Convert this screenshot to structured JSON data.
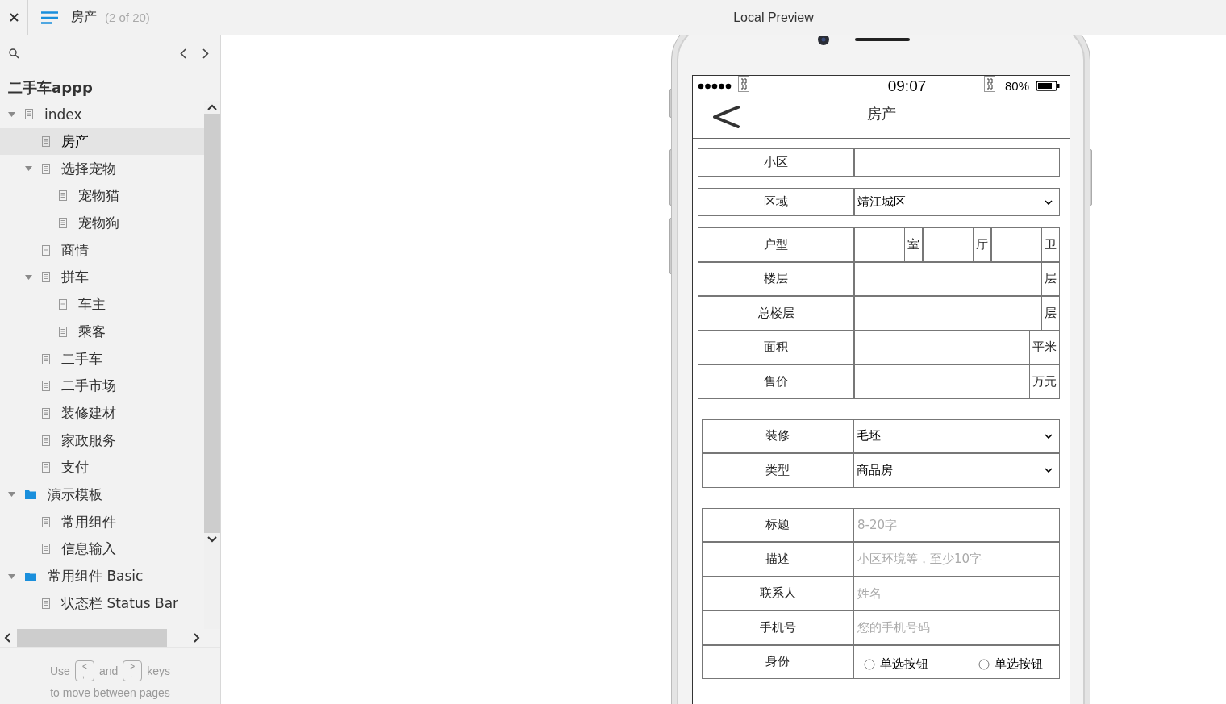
{
  "toolbar": {
    "page_title": "房产",
    "page_count": "(2 of 20)",
    "preview_title": "Local Preview"
  },
  "sidebar": {
    "project": "二手车appp",
    "tree": [
      {
        "label": "index",
        "kind": "page",
        "selected": false,
        "expanded": true,
        "children": [
          {
            "label": "房产",
            "kind": "page",
            "selected": true
          },
          {
            "label": "选择宠物",
            "kind": "page",
            "selected": false,
            "expanded": true,
            "children": [
              {
                "label": "宠物猫",
                "kind": "page",
                "selected": false
              },
              {
                "label": "宠物狗",
                "kind": "page",
                "selected": false
              }
            ]
          },
          {
            "label": "商情",
            "kind": "page",
            "selected": false
          },
          {
            "label": "拼车",
            "kind": "page",
            "selected": false,
            "expanded": true,
            "children": [
              {
                "label": "车主",
                "kind": "page",
                "selected": false
              },
              {
                "label": "乘客",
                "kind": "page",
                "selected": false
              }
            ]
          },
          {
            "label": "二手车",
            "kind": "page",
            "selected": false
          },
          {
            "label": "二手市场",
            "kind": "page",
            "selected": false
          },
          {
            "label": "装修建材",
            "kind": "page",
            "selected": false
          },
          {
            "label": "家政服务",
            "kind": "page",
            "selected": false
          },
          {
            "label": "支付",
            "kind": "page",
            "selected": false
          }
        ]
      },
      {
        "label": "演示模板",
        "kind": "folder",
        "selected": false,
        "expanded": true,
        "children": [
          {
            "label": "常用组件",
            "kind": "page",
            "selected": false
          },
          {
            "label": "信息输入",
            "kind": "page",
            "selected": false
          }
        ]
      },
      {
        "label": "常用组件 Basic",
        "kind": "folder",
        "selected": false,
        "expanded": true,
        "children": [
          {
            "label": "状态栏 Status Bar",
            "kind": "page",
            "selected": false
          }
        ]
      }
    ],
    "hint": {
      "before": "Use",
      "key_prev": [
        "<",
        ","
      ],
      "between": "and",
      "key_next": [
        ">",
        "."
      ],
      "after": "keys",
      "line2": "to move between pages"
    }
  },
  "phone": {
    "status": {
      "time": "09:07",
      "battery": "80%"
    },
    "nav_title": "房产",
    "groups": [
      [
        {
          "kind": "text",
          "label": "小区"
        }
      ],
      [
        {
          "kind": "select",
          "label": "区域",
          "value": "靖江城区"
        }
      ],
      [
        {
          "kind": "rooms",
          "label": "户型",
          "units": [
            "室",
            "厅",
            "卫"
          ]
        },
        {
          "kind": "unit",
          "label": "楼层",
          "unit": "层"
        },
        {
          "kind": "unit",
          "label": "总楼层",
          "unit": "层"
        },
        {
          "kind": "unit",
          "label": "面积",
          "unit": "平米"
        },
        {
          "kind": "unit",
          "label": "售价",
          "unit": "万元"
        }
      ],
      [
        {
          "kind": "select",
          "label": "装修",
          "value": "毛坯"
        },
        {
          "kind": "select",
          "label": "类型",
          "value": "商品房"
        }
      ],
      [
        {
          "kind": "input",
          "label": "标题",
          "placeholder": "8-20字"
        },
        {
          "kind": "input",
          "label": "描述",
          "placeholder": "小区环境等，至少10字"
        },
        {
          "kind": "input",
          "label": "联系人",
          "placeholder": "姓名"
        },
        {
          "kind": "input",
          "label": "手机号",
          "placeholder": "您的手机号码"
        },
        {
          "kind": "radio",
          "label": "身份",
          "options": [
            {
              "label": "单选按钮",
              "selected": false
            },
            {
              "label": "单选按钮",
              "selected": false
            }
          ]
        }
      ]
    ]
  }
}
